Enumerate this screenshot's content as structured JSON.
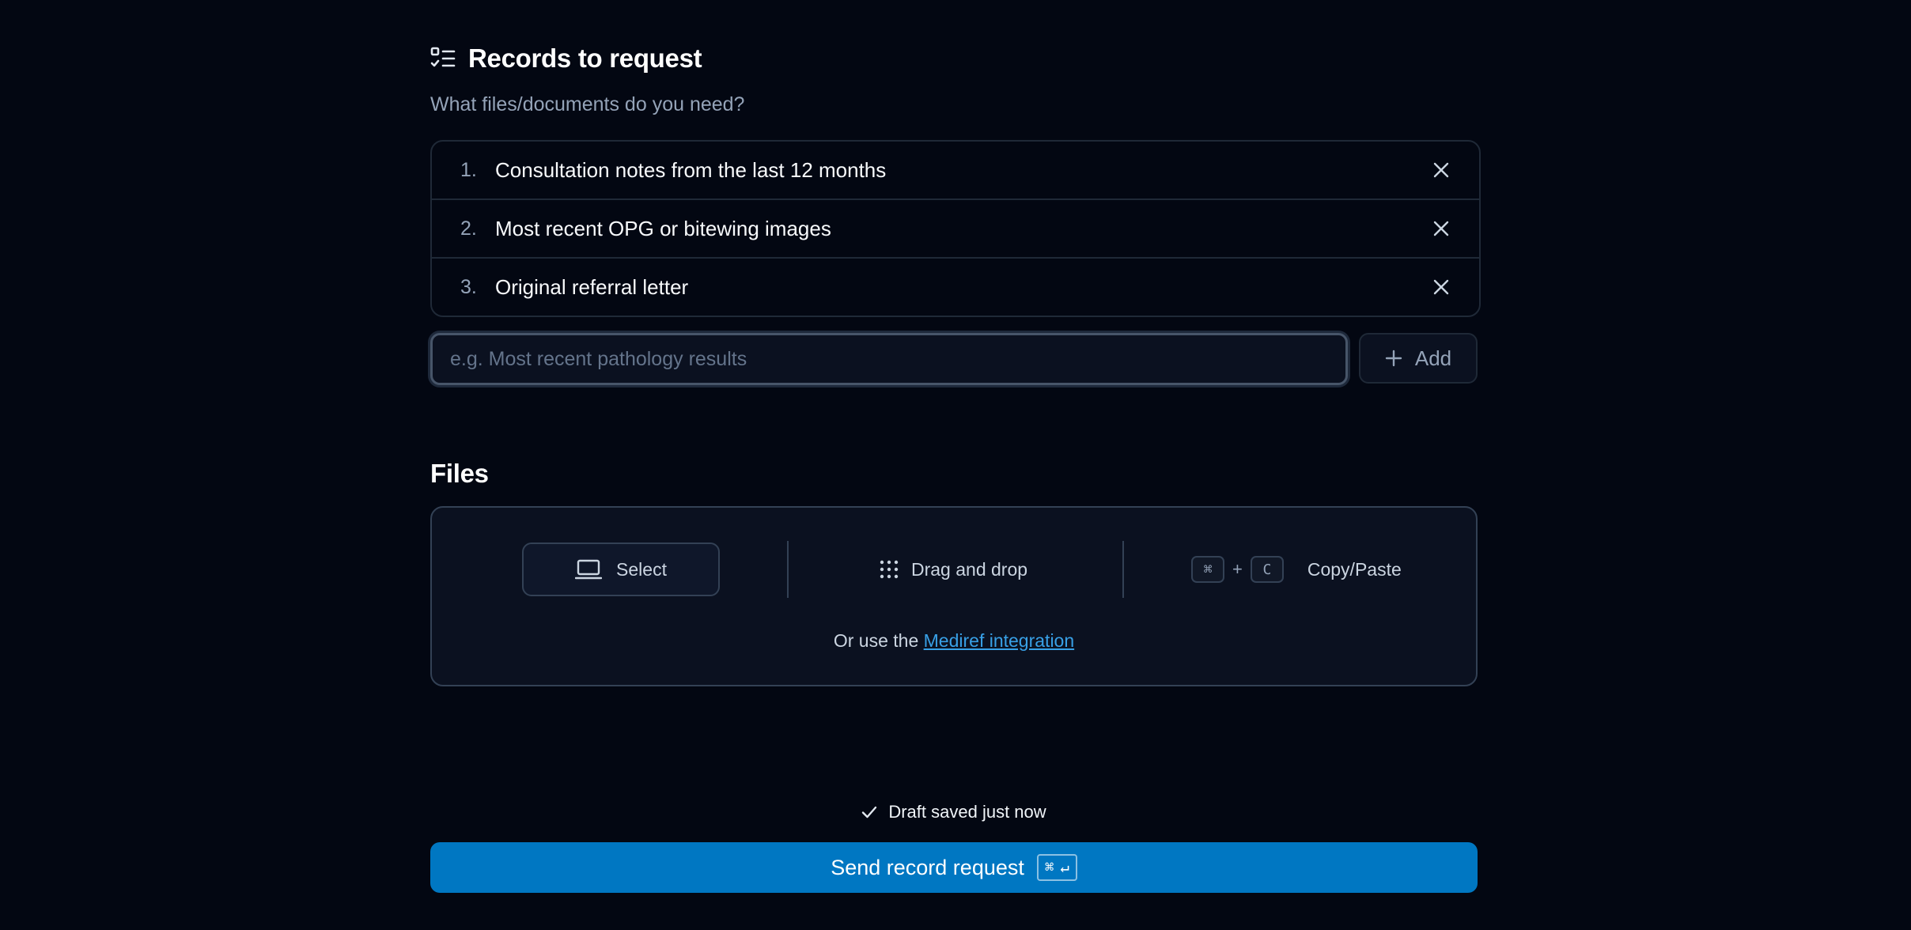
{
  "records": {
    "title": "Records to request",
    "icon": "checklist-icon",
    "subtitle": "What files/documents do you need?",
    "items": [
      {
        "number": "1.",
        "text": "Consultation notes from the last 12 months"
      },
      {
        "number": "2.",
        "text": "Most recent OPG or bitewing images"
      },
      {
        "number": "3.",
        "text": "Original referral letter"
      }
    ],
    "input": {
      "value": "",
      "placeholder": "e.g. Most recent pathology results"
    },
    "add_label": "Add"
  },
  "files": {
    "title": "Files",
    "select_label": "Select",
    "drag_label": "Drag and drop",
    "paste": {
      "key1": "⌘",
      "plus": "+",
      "key2": "C",
      "label": "Copy/Paste"
    },
    "integration_prefix": "Or use the",
    "integration_link": "Mediref integration"
  },
  "footer": {
    "draft_status": "Draft saved just now",
    "send_label": "Send record request",
    "send_shortcut_cmd": "⌘",
    "send_shortcut_enter": "↵"
  },
  "colors": {
    "background": "#030712",
    "primary": "#0077c2",
    "link": "#38a0e6",
    "muted_text": "#94a3b8"
  }
}
